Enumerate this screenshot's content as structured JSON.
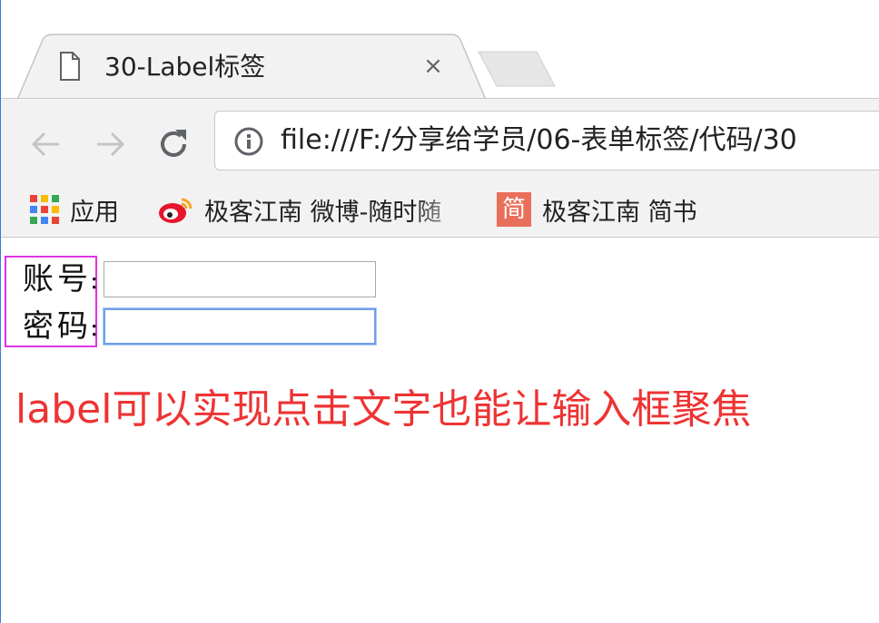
{
  "browser": {
    "tab": {
      "title": "30-Label标签",
      "close_glyph": "×",
      "icon": "file-icon"
    },
    "toolbar": {
      "back_icon": "back-arrow-icon",
      "forward_icon": "forward-arrow-icon",
      "reload_icon": "reload-icon",
      "info_icon": "info-icon",
      "url": "file:///F:/分享给学员/06-表单标签/代码/30"
    },
    "bookmarks": [
      {
        "label": "应用",
        "icon": "apps-grid-icon"
      },
      {
        "label": "极客江南 微博-随时随",
        "icon": "weibo-icon"
      },
      {
        "label": "极客江南 简书",
        "icon": "jianshu-icon",
        "icon_glyph": "简"
      }
    ]
  },
  "page": {
    "form": {
      "account_label": "账号",
      "password_label": "密码",
      "colon": ":",
      "account_value": "",
      "password_value": ""
    },
    "note_latin": "label",
    "note_cjk": "可以实现点击文字也能让输入框聚焦"
  },
  "colors": {
    "label_outline": "#e033e0",
    "note_text": "#ee3333",
    "focus_border": "#6f9fe8"
  }
}
